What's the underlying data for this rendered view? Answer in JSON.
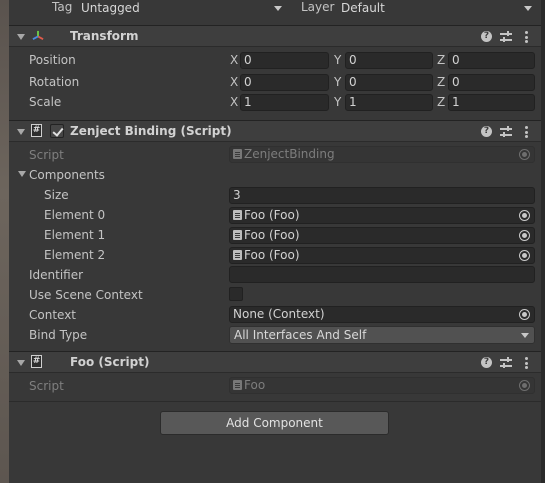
{
  "top": {
    "tag_label": "Tag",
    "tag_value": "Untagged",
    "layer_label": "Layer",
    "layer_value": "Default"
  },
  "transform": {
    "title": "Transform",
    "rows": [
      {
        "label": "Position",
        "x": "0",
        "y": "0",
        "z": "0"
      },
      {
        "label": "Rotation",
        "x": "0",
        "y": "0",
        "z": "0"
      },
      {
        "label": "Scale",
        "x": "1",
        "y": "1",
        "z": "1"
      }
    ],
    "axis_labels": {
      "x": "X",
      "y": "Y",
      "z": "Z"
    }
  },
  "zenject": {
    "title": "Zenject Binding (Script)",
    "enabled": true,
    "script_label": "Script",
    "script_value": "ZenjectBinding",
    "components_label": "Components",
    "size_label": "Size",
    "size_value": "3",
    "elements": [
      {
        "label": "Element 0",
        "value": "Foo (Foo)"
      },
      {
        "label": "Element 1",
        "value": "Foo (Foo)"
      },
      {
        "label": "Element 2",
        "value": "Foo (Foo)"
      }
    ],
    "identifier_label": "Identifier",
    "identifier_value": "",
    "use_scene_context_label": "Use Scene Context",
    "use_scene_context": false,
    "context_label": "Context",
    "context_value": "None (Context)",
    "bind_type_label": "Bind Type",
    "bind_type_value": "All Interfaces And Self"
  },
  "foo": {
    "title": "Foo (Script)",
    "script_label": "Script",
    "script_value": "Foo"
  },
  "add_component_label": "Add Component",
  "icons": {
    "help": "?",
    "script": "#"
  },
  "colors": {
    "background": "#383838",
    "header": "#3e3e3e",
    "field": "#2a2a2a",
    "button": "#585858"
  }
}
